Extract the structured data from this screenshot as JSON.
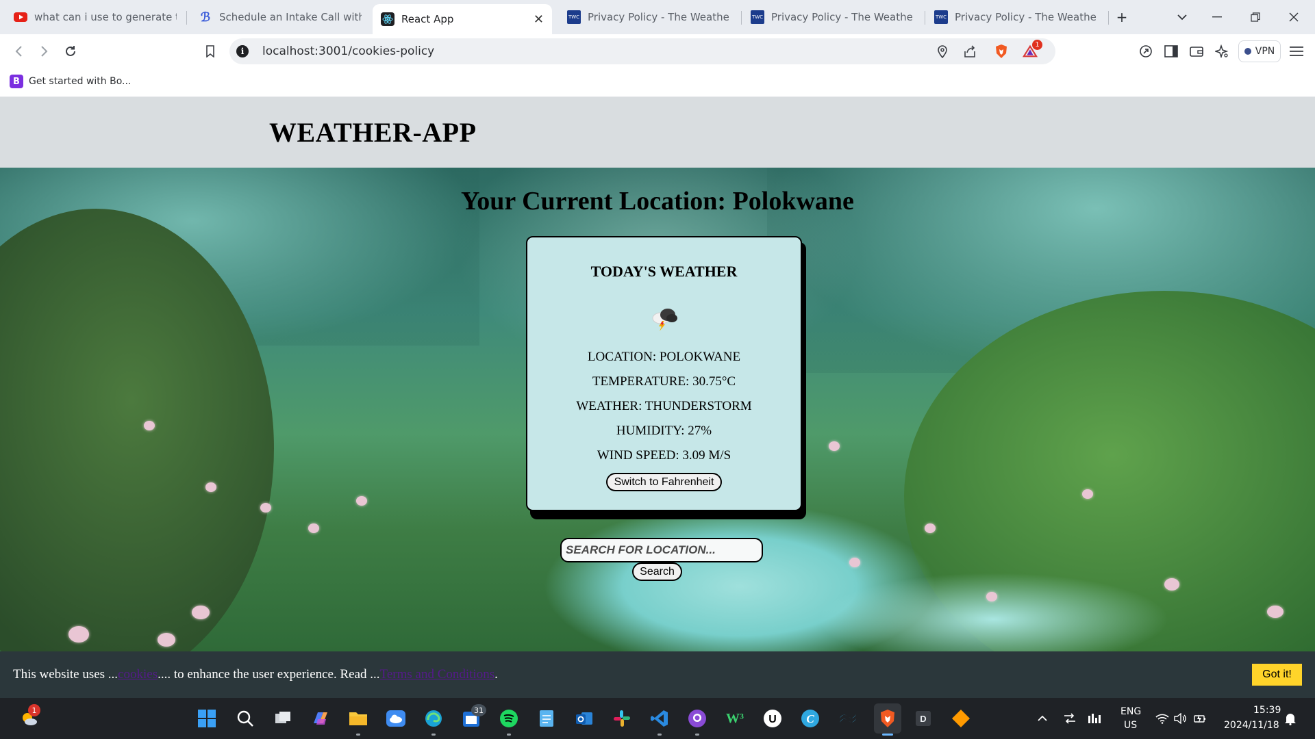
{
  "browser": {
    "tabs": [
      {
        "label": "what can i use to generate term",
        "favicon": "youtube-icon",
        "color": "#e62117"
      },
      {
        "label": "Schedule an Intake Call with Br",
        "favicon": "b-logo-icon",
        "color": "#3a5bd9"
      },
      {
        "label": "React App",
        "favicon": "react-icon",
        "color": "#1f2023"
      },
      {
        "label": "Privacy Policy - The Weather Ch",
        "favicon": "weather-channel-icon",
        "color": "#1c3c8c"
      },
      {
        "label": "Privacy Policy - The Weather Ch",
        "favicon": "weather-channel-icon",
        "color": "#1c3c8c"
      },
      {
        "label": "Privacy Policy - The Weather Ch",
        "favicon": "weather-channel-icon",
        "color": "#1c3c8c"
      }
    ],
    "active_tab_index": 2,
    "close_glyph": "✕",
    "new_tab_glyph": "+",
    "url": "localhost:3001/cookies-policy",
    "vpn_label": "VPN",
    "brave_rewards_badge": "1",
    "bookmark": {
      "icon_letter": "B",
      "label": "Get started with Bo..."
    }
  },
  "page": {
    "app_title": "WEATHER-APP",
    "location_heading": "Your Current Location: Polokwane",
    "card": {
      "title": "TODAY'S WEATHER",
      "icon": "thunderstorm-cloud-icon",
      "location": "LOCATION: POLOKWANE",
      "temperature": "TEMPERATURE: 30.75°C",
      "weather": "WEATHER: THUNDERSTORM",
      "humidity": "HUMIDITY: 27%",
      "wind_speed": "WIND SPEED: 3.09 M/S",
      "toggle_label": "Switch to Fahrenheit"
    },
    "search": {
      "placeholder": "SEARCH FOR LOCATION...",
      "value": "",
      "button_label": "Search"
    },
    "cookie_banner": {
      "text_1": "This website uses ...",
      "link_1": "cookies",
      "text_2": ".... to enhance the user experience. Read ...",
      "link_2": "Terms and Conditions",
      "text_3": ".",
      "button_label": "Got it!",
      "button_color": "#ffd42a",
      "background": "#2b373b"
    }
  },
  "taskbar": {
    "weather_badge": "1",
    "outlook_calendar_badge": "31",
    "language_line1": "ENG",
    "language_line2": "US",
    "time": "15:39",
    "date": "2024/11/18"
  }
}
